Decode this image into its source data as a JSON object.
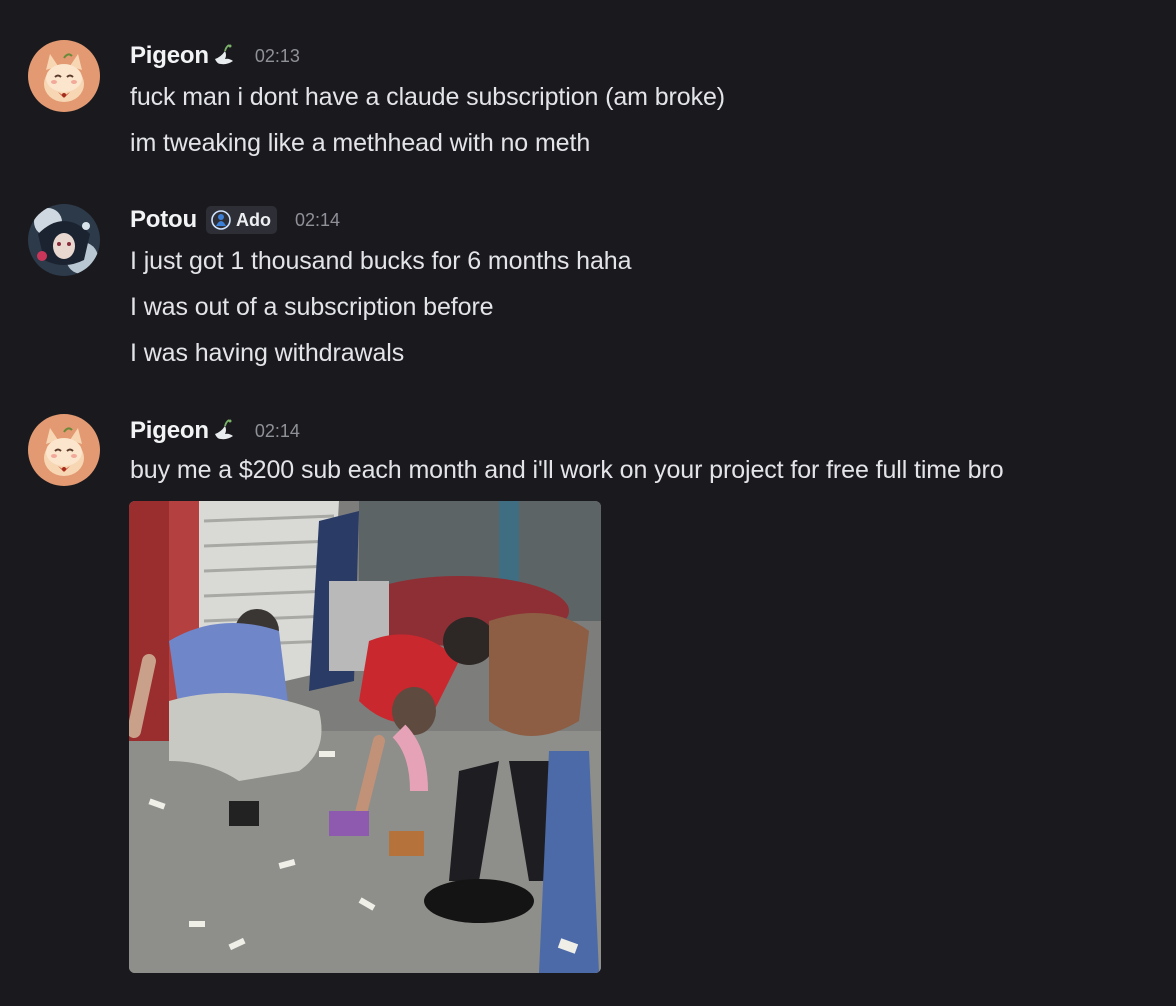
{
  "messages": [
    {
      "author": "Pigeon",
      "author_icon": "dove-icon",
      "time": "02:13",
      "lines": [
        "fuck man i dont have a claude subscription (am broke)",
        "im tweaking like a methhead with no meth"
      ]
    },
    {
      "author": "Potou",
      "tag": "Ado",
      "tag_icon": "guild-tag-icon",
      "time": "02:14",
      "lines": [
        "I just got 1 thousand bucks for 6 months haha",
        "I was out of a subscription before",
        "I was having withdrawals"
      ]
    },
    {
      "author": "Pigeon",
      "author_icon": "dove-icon",
      "time": "02:14",
      "lines": [
        "buy me a $200 sub each month and i'll work on your project for free full time bro"
      ],
      "attachment": "gif-attachment"
    }
  ],
  "colors": {
    "background": "#1a1a1e",
    "username": "#f2f3f5",
    "timestamp": "#8f9098",
    "message_text": "#e3e4e8",
    "tag_bg": "#2e2f36"
  }
}
